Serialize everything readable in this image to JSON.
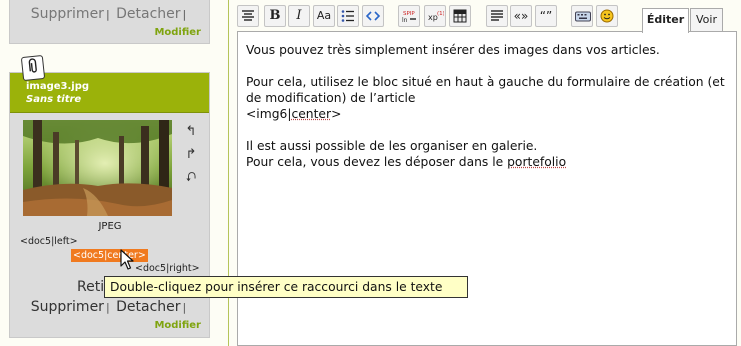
{
  "top_card": {
    "delete_label": "Supprimer",
    "sep": "|",
    "detach_label": "Detacher",
    "modify_label": "Modifier"
  },
  "doc_card": {
    "filename": "image3.jpg",
    "title": "Sans titre",
    "file_type": "JPEG",
    "shortcut_left": "<doc5|left>",
    "shortcut_center": "<doc5|center>",
    "shortcut_right": "<doc5|right>",
    "remove_label": "Retir",
    "delete_label": "Supprimer",
    "sep": "|",
    "detach_label": "Detacher",
    "modify_label": "Modifier"
  },
  "toolbar": {
    "bold": "B",
    "italic": "I",
    "caps": "Aa",
    "quote_open": "«»",
    "quote_close": "“”",
    "tab_edit": "Éditer",
    "tab_view": "Voir"
  },
  "editor": {
    "line1": "Vous pouvez très simplement insérer des images dans vos articles.",
    "line2": "Pour cela, utilisez le bloc situé en haut à gauche du formulaire de création (et de modification) de l’article",
    "line3_a": "<img6|",
    "line3_b": "center",
    "line3_c": ">",
    "line4": "Il est aussi possible de les organiser en galerie.",
    "line5_a": "Pour cela, vous devez les déposer dans le ",
    "line5_b": "portefolio"
  },
  "tooltip": "Double-cliquez pour insérer ce raccourci dans le texte",
  "colors": {
    "header_green": "#9bb20a",
    "modify_green": "#7fa40f",
    "highlight_orange": "#f07a1f",
    "tooltip_bg": "#ffffc6"
  }
}
